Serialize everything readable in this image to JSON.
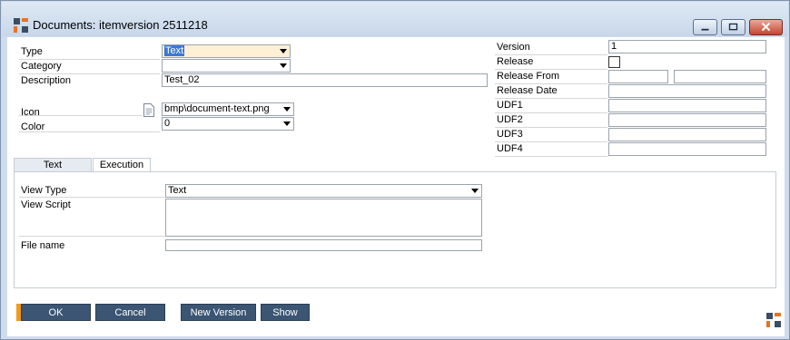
{
  "window": {
    "title": "Documents: itemversion 2511218"
  },
  "form": {
    "type": {
      "label": "Type",
      "value": "Text"
    },
    "category": {
      "label": "Category",
      "value": ""
    },
    "description": {
      "label": "Description",
      "value": "Test_02"
    },
    "icon": {
      "label": "Icon",
      "value": "bmp\\document-text.png"
    },
    "color": {
      "label": "Color",
      "value": "0"
    }
  },
  "right_form": {
    "version": {
      "label": "Version",
      "value": "1"
    },
    "release": {
      "label": "Release"
    },
    "release_from": {
      "label": "Release From",
      "value_1": "",
      "value_2": ""
    },
    "release_date": {
      "label": "Release Date",
      "value": ""
    },
    "udf1": {
      "label": "UDF1",
      "value": ""
    },
    "udf2": {
      "label": "UDF2",
      "value": ""
    },
    "udf3": {
      "label": "UDF3",
      "value": ""
    },
    "udf4": {
      "label": "UDF4",
      "value": ""
    }
  },
  "tabs": [
    {
      "label": "Text",
      "active": false
    },
    {
      "label": "Execution",
      "active": true
    }
  ],
  "execution": {
    "view_type": {
      "label": "View Type",
      "value": "Text"
    },
    "view_script": {
      "label": "View Script",
      "value": ""
    },
    "file_name": {
      "label": "File name",
      "value": ""
    }
  },
  "buttons": {
    "ok": "OK",
    "cancel": "Cancel",
    "new_version": "New Version",
    "show": "Show"
  },
  "colors": {
    "button_bg": "#3b5573",
    "accent": "#f29a1d",
    "title_bar": "#cfdcec"
  }
}
